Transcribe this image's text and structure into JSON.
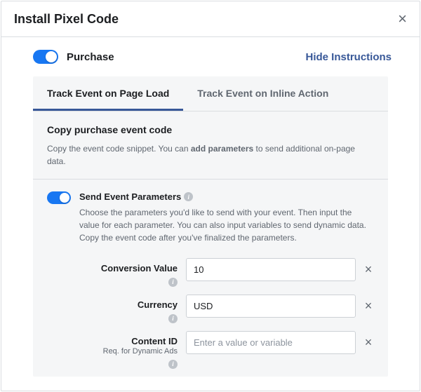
{
  "header": {
    "title": "Install Pixel Code"
  },
  "subheader": {
    "toggle_on": true,
    "label": "Purchase",
    "hide_link": "Hide Instructions"
  },
  "tabs": [
    {
      "label": "Track Event on Page Load",
      "active": true
    },
    {
      "label": "Track Event on Inline Action",
      "active": false
    }
  ],
  "copy_section": {
    "heading": "Copy purchase event code",
    "desc_pre": "Copy the event code snippet. You can ",
    "desc_bold": "add parameters",
    "desc_post": " to send additional on-page data."
  },
  "params_toggle": {
    "on": true,
    "title": "Send Event Parameters",
    "desc": "Choose the parameters you'd like to send with your event. Then input the value for each parameter. You can also input variables to send dynamic data. Copy the event code after you've finalized the parameters."
  },
  "fields": [
    {
      "label": "Conversion Value",
      "sublabel": "",
      "value": "10",
      "placeholder": "",
      "clearable": true
    },
    {
      "label": "Currency",
      "sublabel": "",
      "value": "USD",
      "placeholder": "",
      "clearable": true
    },
    {
      "label": "Content ID",
      "sublabel": "Req. for Dynamic Ads",
      "value": "",
      "placeholder": "Enter a value or variable",
      "clearable": true
    }
  ]
}
